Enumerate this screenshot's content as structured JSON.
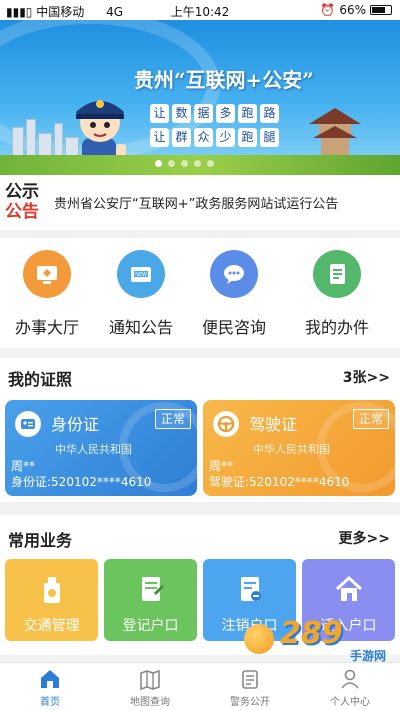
{
  "status_bar": {
    "carrier": "中国移动",
    "network": "4G",
    "time": "上午10:42",
    "battery": "66%"
  },
  "banner": {
    "title": "贵州“互联网+公安”",
    "slogan_row1": [
      "让",
      "数",
      "据",
      "多",
      "跑",
      "路"
    ],
    "slogan_row2": [
      "让",
      "群",
      "众",
      "少",
      "跑",
      "腿"
    ]
  },
  "notice": {
    "tag_top": "公示",
    "tag_bottom": "公告",
    "text": "贵州省公安厅“互联网+”政务服务网站试运行公告"
  },
  "services": [
    {
      "label": "办事大厅",
      "icon": "hall-icon",
      "color": "#f39a3a"
    },
    {
      "label": "通知公告",
      "icon": "notice-icon",
      "color": "#4aa8e6"
    },
    {
      "label": "便民咨询",
      "icon": "chat-icon",
      "color": "#5b8de8"
    },
    {
      "label": "我的办件",
      "icon": "document-icon",
      "color": "#53b86b"
    }
  ],
  "certificates": {
    "title": "我的证照",
    "count": "3张>>",
    "cards": [
      {
        "name": "身份证",
        "status": "正常",
        "country": "中华人民共和国",
        "holder": "周**",
        "number": "身份证:520102****4610",
        "icon": "id-card-icon",
        "color": "#3d8fe0"
      },
      {
        "name": "驾驶证",
        "status": "正常",
        "country": "中华人民共和国",
        "holder": "周**",
        "number": "驾驶证:520102****4610",
        "icon": "steering-wheel-icon",
        "color": "#f6a93c"
      }
    ]
  },
  "common": {
    "title": "常用业务",
    "more": "更多>>",
    "tiles": [
      {
        "label": "交通管理",
        "icon": "traffic-icon",
        "color": "#f8c14a"
      },
      {
        "label": "登记户口",
        "icon": "register-icon",
        "color": "#6cc45e"
      },
      {
        "label": "注销户口",
        "icon": "cancel-register-icon",
        "color": "#4da4ef"
      },
      {
        "label": "迁入户口",
        "icon": "move-in-icon",
        "color": "#8a8ef0"
      }
    ]
  },
  "tabbar": [
    {
      "label": "首页",
      "icon": "home-icon",
      "active": true
    },
    {
      "label": "地图查询",
      "icon": "map-icon",
      "active": false
    },
    {
      "label": "警务公开",
      "icon": "police-affairs-icon",
      "active": false
    },
    {
      "label": "个人中心",
      "icon": "user-icon",
      "active": false
    }
  ],
  "watermark": {
    "big": "289",
    "small": "手游网"
  }
}
